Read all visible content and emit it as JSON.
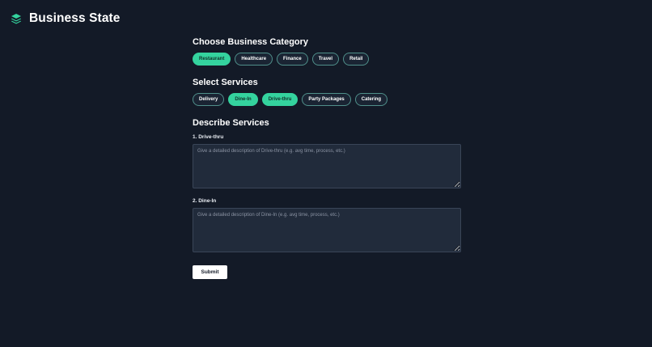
{
  "app": {
    "title": "Business State",
    "logo_icon": "layers-icon",
    "accent_color": "#34d39e",
    "background_color": "#131a27"
  },
  "category": {
    "title": "Choose Business Category",
    "options": [
      "Restaurant",
      "Healthcare",
      "Finance",
      "Travel",
      "Retail"
    ],
    "selected": [
      "Restaurant"
    ]
  },
  "services": {
    "title": "Select Services",
    "options": [
      "Delivery",
      "Dine-In",
      "Drive-thru",
      "Party Packages",
      "Catering"
    ],
    "selected": [
      "Dine-In",
      "Drive-thru"
    ]
  },
  "describe": {
    "title": "Describe Services",
    "fields": [
      {
        "label": "1. Drive-thru",
        "value": "",
        "placeholder": "Give a detailed description of Drive-thru (e.g. avg time, process, etc.)"
      },
      {
        "label": "2. Dine-In",
        "value": "",
        "placeholder": "Give a detailed description of Dine-In (e.g. avg time, process, etc.)"
      }
    ]
  },
  "submit_label": "Submit"
}
